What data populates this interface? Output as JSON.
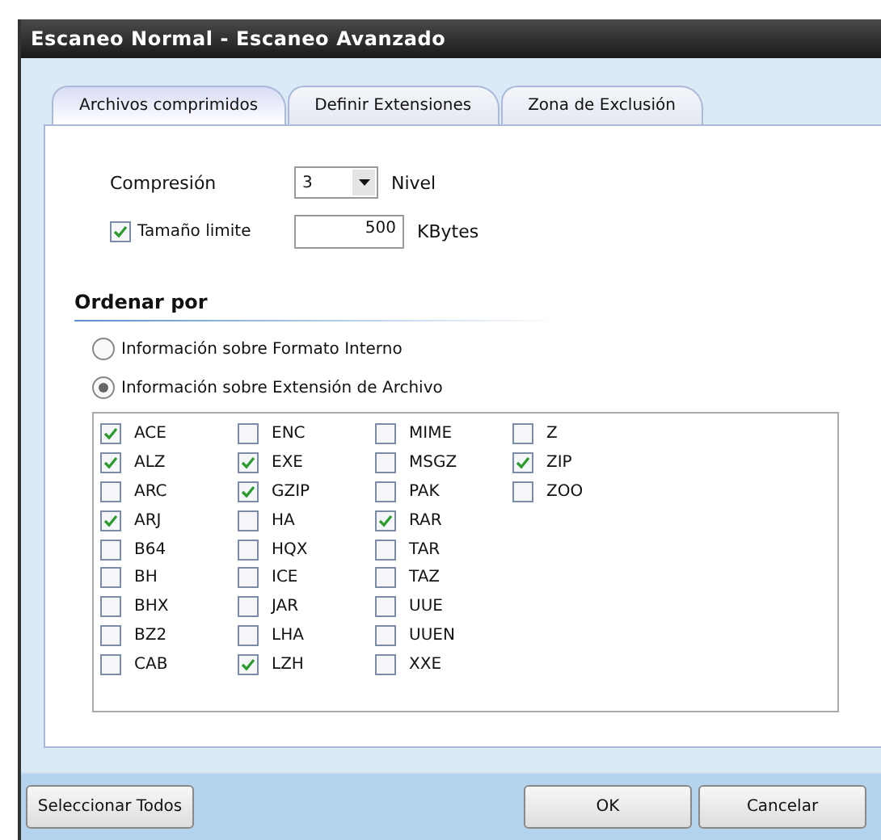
{
  "window": {
    "title": "Escaneo Normal - Escaneo Avanzado"
  },
  "tabs": [
    {
      "label": "Archivos comprimidos",
      "selected": true
    },
    {
      "label": "Definir Extensiones",
      "selected": false
    },
    {
      "label": "Zona de Exclusión",
      "selected": false
    }
  ],
  "compression": {
    "label": "Compresión",
    "value": "3",
    "unit": "Nivel"
  },
  "size_limit": {
    "label": "Tamaño limite",
    "checked": true,
    "value": "500",
    "unit": "KBytes"
  },
  "sort": {
    "heading": "Ordenar por",
    "options": [
      {
        "label": "Información sobre Formato Interno",
        "selected": false
      },
      {
        "label": "Información sobre Extensión de Archivo",
        "selected": true
      }
    ]
  },
  "extensions": [
    [
      {
        "label": "ACE",
        "checked": true
      },
      {
        "label": "ALZ",
        "checked": true
      },
      {
        "label": "ARC",
        "checked": false
      },
      {
        "label": "ARJ",
        "checked": true
      },
      {
        "label": "B64",
        "checked": false
      },
      {
        "label": "BH",
        "checked": false
      },
      {
        "label": "BHX",
        "checked": false
      },
      {
        "label": "BZ2",
        "checked": false
      },
      {
        "label": "CAB",
        "checked": false
      }
    ],
    [
      {
        "label": "ENC",
        "checked": false
      },
      {
        "label": "EXE",
        "checked": true
      },
      {
        "label": "GZIP",
        "checked": true
      },
      {
        "label": "HA",
        "checked": false
      },
      {
        "label": "HQX",
        "checked": false
      },
      {
        "label": "ICE",
        "checked": false
      },
      {
        "label": "JAR",
        "checked": false
      },
      {
        "label": "LHA",
        "checked": false
      },
      {
        "label": "LZH",
        "checked": true
      }
    ],
    [
      {
        "label": "MIME",
        "checked": false
      },
      {
        "label": "MSGZ",
        "checked": false
      },
      {
        "label": "PAK",
        "checked": false
      },
      {
        "label": "RAR",
        "checked": true
      },
      {
        "label": "TAR",
        "checked": false
      },
      {
        "label": "TAZ",
        "checked": false
      },
      {
        "label": "UUE",
        "checked": false
      },
      {
        "label": "UUEN",
        "checked": false
      },
      {
        "label": "XXE",
        "checked": false
      }
    ],
    [
      {
        "label": "Z",
        "checked": false
      },
      {
        "label": "ZIP",
        "checked": true
      },
      {
        "label": "ZOO",
        "checked": false
      }
    ]
  ],
  "buttons": {
    "left": "Seleccionar Todos",
    "ok": "OK",
    "cancel": "Cancelar"
  }
}
